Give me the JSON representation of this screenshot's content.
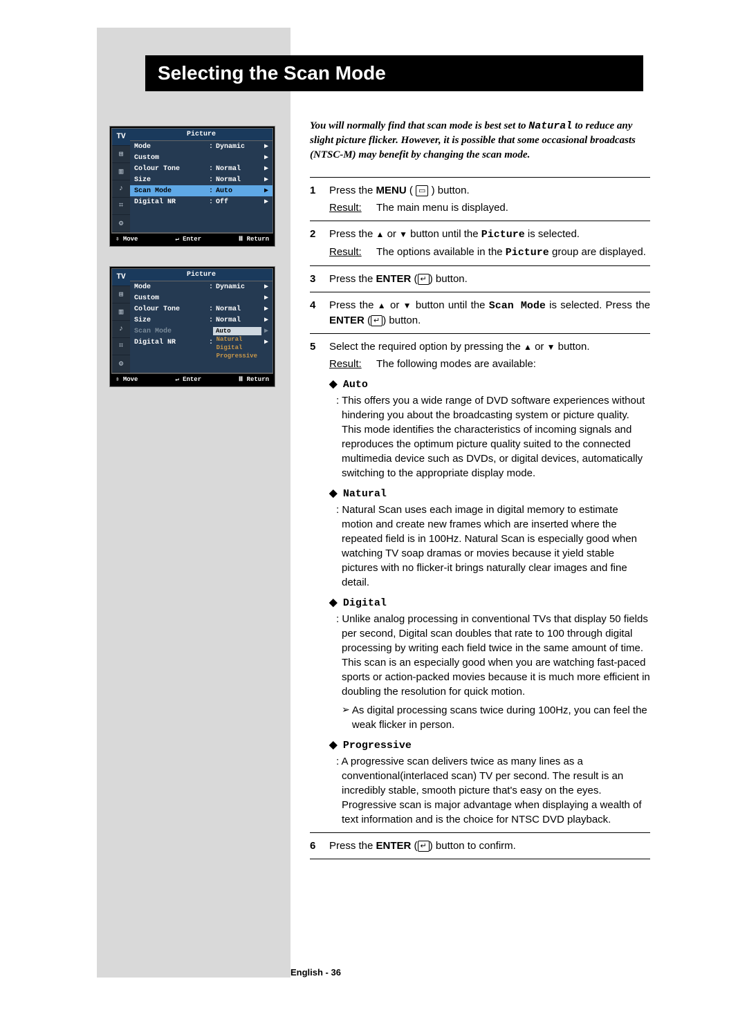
{
  "header": {
    "title": "Selecting the Scan Mode"
  },
  "intro": {
    "t1": "You will normally find that scan mode is best set to ",
    "nat": "Natural",
    "t2": " to reduce any slight picture flicker. However, it is possible that some occasional broadcasts (NTSC-M) may benefit by changing the scan mode."
  },
  "osd": {
    "tv": "TV",
    "title": "Picture",
    "rows": [
      {
        "label": "Mode",
        "colon": ":",
        "value": "Dynamic",
        "arrow": "▶"
      },
      {
        "label": "Custom",
        "colon": "",
        "value": "",
        "arrow": "▶"
      },
      {
        "label": "Colour Tone",
        "colon": ":",
        "value": "Normal",
        "arrow": "▶"
      },
      {
        "label": "Size",
        "colon": ":",
        "value": "Normal",
        "arrow": "▶"
      },
      {
        "label": "Scan Mode",
        "colon": ":",
        "value": "Auto",
        "arrow": "▶",
        "sel": true
      },
      {
        "label": "Digital NR",
        "colon": ":",
        "value": "Off",
        "arrow": "▶"
      }
    ],
    "footer": {
      "move": "Move",
      "enter": "Enter",
      "ret": "Return"
    },
    "subopts": [
      "Auto",
      "Natural",
      "Digital",
      "Progressive"
    ]
  },
  "steps": {
    "s1": {
      "num": "1",
      "a": "Press the ",
      "menu": "MENU",
      "b": " ( ",
      "c": " )   button.",
      "rlabel": "Result:",
      "rtext": "The main menu is displayed."
    },
    "s2": {
      "num": "2",
      "a": "Press the ",
      "b": " or ",
      "c": " button until the ",
      "picture": "Picture",
      "d": " is selected.",
      "rlabel": "Result:",
      "rtext": "The options available in the ",
      "picture2": "Picture",
      "rtext2": " group are displayed."
    },
    "s3": {
      "num": "3",
      "a": "Press the ",
      "enter": "ENTER",
      "b": " (",
      "c": ") button."
    },
    "s4": {
      "num": "4",
      "a": "Press the ",
      "b": " or ",
      "c": " button until the ",
      "scan": "Scan Mode",
      "d": " is selected. Press the ",
      "enter": "ENTER",
      "e": " (",
      "f": ") button."
    },
    "s5": {
      "num": "5",
      "a": "Select the required option by pressing the ",
      "b": " or ",
      "c": " button.",
      "rlabel": "Result:",
      "rtext": "The following modes are available:",
      "modes": {
        "auto": {
          "title": "Auto",
          "desc": ": This offers you a wide range of DVD software experiences without hindering you about the broadcasting system or picture quality. This mode identifies the characteristics of incoming signals and reproduces the optimum picture quality suited to the connected multimedia device such as DVDs, or digital devices, automatically switching to the appropriate display mode."
        },
        "natural": {
          "title": "Natural",
          "desc": ": Natural Scan uses each image in digital memory to estimate motion and create new frames which are inserted where the repeated field is in 100Hz. Natural Scan is especially good when watching TV soap dramas or movies because it yield stable pictures with no flicker-it brings naturally clear images and fine detail."
        },
        "digital": {
          "title": "Digital",
          "desc": ": Unlike analog processing in conventional TVs that display 50 fields per second, Digital scan doubles that rate to 100 through digital processing by writing each field twice in the same amount of time. This scan is an especially good when you are watching fast-paced sports or action-packed movies because it is much more efficient in doubling the resolution for quick motion.",
          "note": "As digital processing scans twice during 100Hz, you can feel the weak flicker in person."
        },
        "progressive": {
          "title": "Progressive",
          "desc": ": A progressive scan delivers twice as many lines as a conventional(interlaced scan) TV per second. The result is an incredibly stable, smooth picture that's easy on the eyes. Progressive scan is major advantage when displaying a wealth of text information and is the choice for NTSC DVD playback."
        }
      }
    },
    "s6": {
      "num": "6",
      "a": "Press the ",
      "enter": "ENTER",
      "b": " (",
      "c": ") button to confirm."
    }
  },
  "footer": {
    "page": "English - 36"
  },
  "glyphs": {
    "up": "▲",
    "down": "▼",
    "diamond": "◆",
    "note": "➢",
    "menu_icon": "▭",
    "enter_icon": "↵",
    "updown": "⇳",
    "ret": "Ⅲ"
  }
}
